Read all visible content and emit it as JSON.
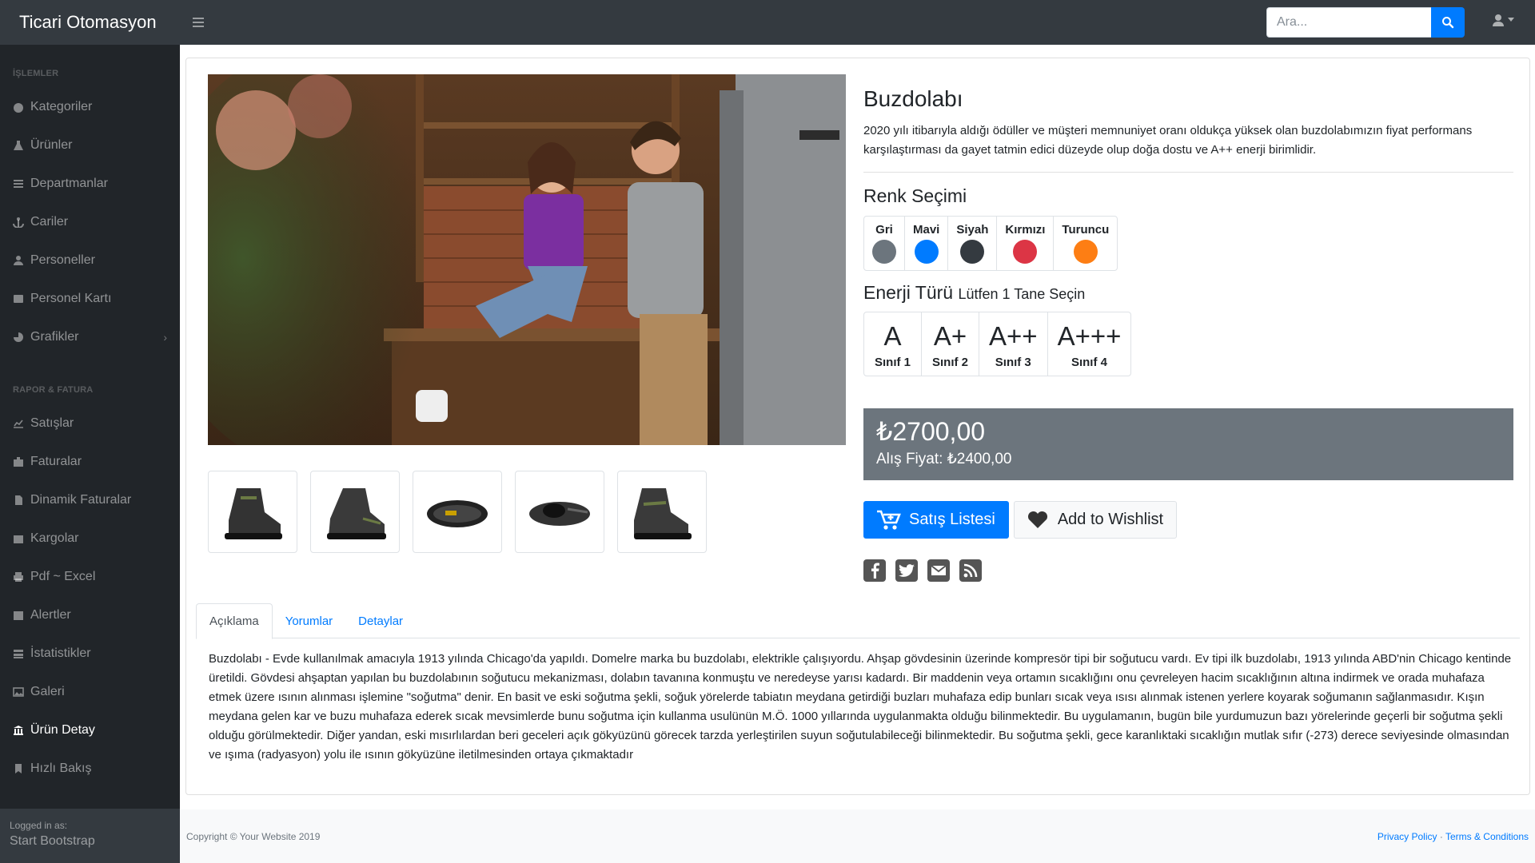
{
  "app": {
    "brand": "Ticari Otomasyon"
  },
  "search": {
    "placeholder": "Ara..."
  },
  "sidebar": {
    "section1": "İŞLEMLER",
    "section2": "RAPOR & FATURA",
    "items1": [
      {
        "label": "Kategoriler",
        "icon": "dashboard-icon"
      },
      {
        "label": "Ürünler",
        "icon": "flask-icon"
      },
      {
        "label": "Departmanlar",
        "icon": "list-icon"
      },
      {
        "label": "Cariler",
        "icon": "anchor-icon"
      },
      {
        "label": "Personeller",
        "icon": "user-icon"
      },
      {
        "label": "Personel Kartı",
        "icon": "id-card-icon"
      },
      {
        "label": "Grafikler",
        "icon": "pie-chart-icon"
      }
    ],
    "items2": [
      {
        "label": "Satışlar",
        "icon": "line-chart-icon"
      },
      {
        "label": "Faturalar",
        "icon": "briefcase-icon"
      },
      {
        "label": "Dinamik Faturalar",
        "icon": "file-icon"
      },
      {
        "label": "Kargolar",
        "icon": "gift-icon"
      },
      {
        "label": "Pdf ~ Excel",
        "icon": "print-icon"
      },
      {
        "label": "Alertler",
        "icon": "calendar-icon"
      },
      {
        "label": "İstatistikler",
        "icon": "tasks-icon"
      },
      {
        "label": "Galeri",
        "icon": "image-icon"
      },
      {
        "label": "Ürün Detay",
        "icon": "bank-icon"
      },
      {
        "label": "Hızlı Bakış",
        "icon": "bookmark-icon"
      }
    ],
    "footer_small": "Logged in as:",
    "footer_name": "Start Bootstrap"
  },
  "product": {
    "title": "Buzdolabı",
    "description": "2020 yılı itibarıyla aldığı ödüller ve müşteri memnuniyet oranı oldukça yüksek olan buzdolabımızın fiyat performans karşılaştırması da gayet tatmin edici düzeyde olup doğa dostu ve A++ enerji birimlidir.",
    "color_heading": "Renk Seçimi",
    "colors": [
      {
        "label": "Gri",
        "hex": "#6c757d"
      },
      {
        "label": "Mavi",
        "hex": "#007bff"
      },
      {
        "label": "Siyah",
        "hex": "#343a40"
      },
      {
        "label": "Kırmızı",
        "hex": "#dc3545"
      },
      {
        "label": "Turuncu",
        "hex": "#fd7e14"
      }
    ],
    "energy_heading": "Enerji Türü",
    "energy_sub": "Lütfen 1 Tane Seçin",
    "energy": [
      {
        "grade": "A",
        "cls": "Sınıf 1"
      },
      {
        "grade": "A+",
        "cls": "Sınıf 2"
      },
      {
        "grade": "A++",
        "cls": "Sınıf 3"
      },
      {
        "grade": "A+++",
        "cls": "Sınıf 4"
      }
    ],
    "price": "₺2700,00",
    "buy_price": "Alış Fiyat: ₺2400,00",
    "btn_sales": "Satış Listesi",
    "btn_wishlist": "Add to Wishlist",
    "social": [
      "facebook-icon",
      "twitter-icon",
      "envelope-icon",
      "rss-icon"
    ]
  },
  "tabs": [
    "Açıklama",
    "Yorumlar",
    "Detaylar"
  ],
  "tab_content": "Buzdolabı - Evde kullanılmak amacıyla 1913 yılında Chicago'da yapıldı. Domelre marka bu buzdolabı, elektrikle çalışıyordu. Ahşap gövdesinin üzerinde kompresör tipi bir soğutucu vardı. Ev tipi ilk buzdolabı, 1913 yılında ABD'nin Chicago kentinde üretildi. Gövdesi ahşaptan yapılan bu buzdolabının soğutucu mekanizması, dolabın tavanına konmuştu ve neredeyse yarısı kadardı. Bir maddenin veya ortamın sıcaklığını onu çevreleyen hacim sıcaklığının altına indirmek ve orada muhafaza etmek üzere ısının alınması işlemine \"soğutma\" denir. En basit ve eski soğutma şekli, soğuk yörelerde tabiatın meydana getirdiği buzları muhafaza edip bunları sıcak veya ısısı alınmak istenen yerlere koyarak soğumanın sağlanmasıdır. Kışın meydana gelen kar ve buzu muhafaza ederek sıcak mevsimlerde bunu soğutma için kullanma usulünün M.Ö. 1000 yıllarında uygulanmakta olduğu bilinmektedir. Bu uygulamanın, bugün bile yurdumuzun bazı yörelerinde geçerli bir soğutma şekli olduğu görülmektedir. Diğer yandan, eski mısırlılardan beri geceleri açık gökyüzünü görecek tarzda yerleştirilen suyun soğutulabileceği bilinmektedir. Bu soğutma şekli, gece karanlıktaki sıcaklığın mutlak sıfır (-273) derece seviyesinde olmasından ve ışıma (radyasyon) yolu ile ısının gökyüzüne iletilmesinden ortaya çıkmaktadır",
  "footer": {
    "copyright": "Copyright © Your Website 2019",
    "privacy": "Privacy Policy",
    "sep": " · ",
    "terms": "Terms & Conditions"
  }
}
